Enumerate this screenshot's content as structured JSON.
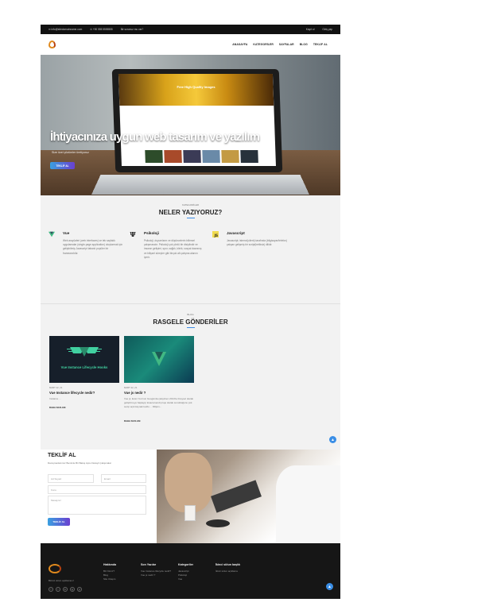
{
  "topbar": {
    "email": "✉ info@sitedomainname.com",
    "phone": "✆ +90 555 5555555",
    "question": "Bir sorunuz mu var?",
    "register": "Kayıt ol",
    "login": "Giriş yap"
  },
  "nav": {
    "items": [
      "ANASAYFA",
      "KATEGORİLER",
      "SAYFALAR",
      "BLOG",
      "TEKLİF AL"
    ]
  },
  "hero": {
    "title": "İhtiyacınıza uygun web tasarım ve yazılım",
    "subtitle": "Size özel çözümler üretiyoruz",
    "button": "TEKLİF AL",
    "screen_text": "Free High Quality Images"
  },
  "categories": {
    "eyebrow": "KATEGORİLER",
    "title": "NELER YAZIYORUZ?",
    "items": [
      {
        "name": "Vue",
        "icon": "vue-icon",
        "desc": "Web arayüzleri (web interfaces) ve tek sayfalık uygulamalar (single-page application) oluşturmak için geliştirilmiş Javascript tabanlı popüler bir frameworktür."
      },
      {
        "name": "Psikoloji",
        "icon": "psi-icon",
        "desc": "Psikoloji, duyumların ve düşüncelerin bilimsel çalışmasıdır. Psikoloji çok yönlü bir disiplindir ve insanın gelişimi, spor, sağlık, klinik, sosyal davranış ve bilişsel süreçler gibi birçok alt çalışma alanını içerir."
      },
      {
        "name": "Javascript",
        "icon": "js-icon",
        "desc": "Javascript; istemci(client) tarafında (bilgisayar/telefon) çalışan gelişmiş bir script(betiksiz) dilidir."
      }
    ]
  },
  "posts": {
    "eyebrow": "BLOG",
    "title": "RASGELE GÖNDERİLER",
    "items": [
      {
        "thumb_text": "Vue Instance Lifecycle Hooks",
        "date": "MART 22, 21",
        "title": "Vue Instance lifecycle nedir?",
        "excerpt": "Instance ...",
        "more": "DAHA FAZLASI"
      },
      {
        "thumb_text": "",
        "date": "MART 22, 21",
        "title": "Vue js nedir ?",
        "excerpt": "Vue js; Evan You'nun Google'da çalışırken 2014'te bireysel olarak geliştirmeye başlayıp kısaca kendi proje olarak sunulduğunu çok sevip açık kaynak kodlu ... Dilişim...",
        "more": "DAHA FAZLASI"
      }
    ]
  },
  "quote": {
    "title": "TEKLİF AL",
    "subtitle": "Danışmanlarımız Benimle Bir Bakış Açısı Detaylı Çalışmalar",
    "name_placeholder": "Ad Soyad",
    "email_placeholder": "Email",
    "subject_placeholder": "Konu",
    "message_placeholder": "Mesajınız",
    "button": "TEKLİF AL"
  },
  "footer": {
    "about": "Birinci sütun açıklama 2",
    "columns": [
      {
        "title": "Hakkında",
        "links": [
          "Biz Kimiz?",
          "Blog",
          "Site Ulaşım"
        ]
      },
      {
        "title": "Son Yazılar",
        "links": [
          "Vue Instance lifecycle nedir?",
          "Vue js nedir ?"
        ]
      },
      {
        "title": "Kategoriler",
        "links": [
          "Javascript",
          "Psikoloji",
          "Vue"
        ]
      },
      {
        "title": "İkinci sütun başlık",
        "links": [
          "İkinci sütun açıklama"
        ]
      }
    ],
    "socials": [
      "f",
      "t",
      "in",
      "ig",
      "yt"
    ]
  },
  "colors": {
    "accent": "#3a8ee6",
    "gradient_start": "#3aa0e0",
    "gradient_end": "#6a3fd0",
    "vue_green": "#41b883",
    "logo_orange": "#e08a1e"
  }
}
